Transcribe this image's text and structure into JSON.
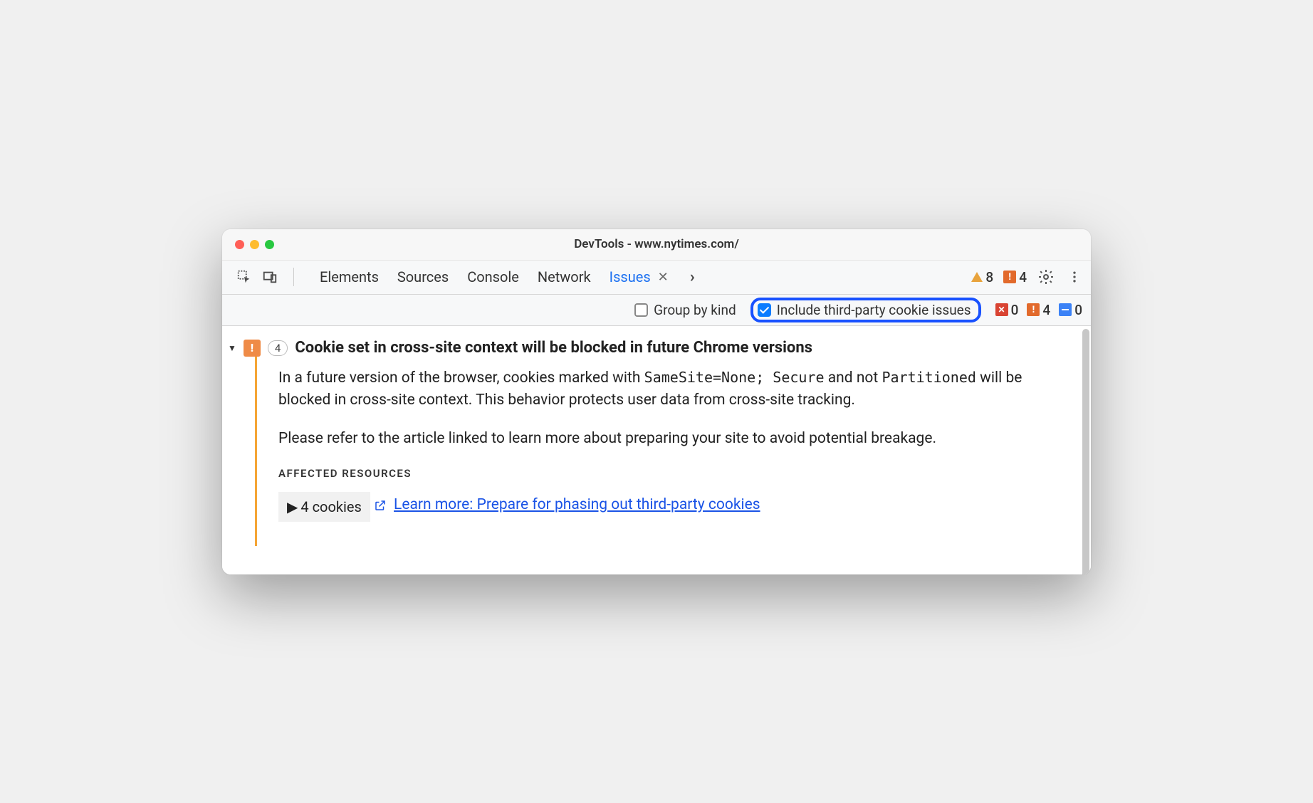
{
  "window_title": "DevTools - www.nytimes.com/",
  "tabs": {
    "elements": "Elements",
    "sources": "Sources",
    "console": "Console",
    "network": "Network",
    "issues": "Issues"
  },
  "toolbar_counts": {
    "warnings": "8",
    "breaking": "4"
  },
  "filter": {
    "group_by_kind_label": "Group by kind",
    "group_by_kind_checked": false,
    "third_party_label": "Include third-party cookie issues",
    "third_party_checked": true
  },
  "filter_counts": {
    "errors": "0",
    "warnings": "4",
    "info": "0"
  },
  "issue": {
    "count": "4",
    "title": "Cookie set in cross-site context will be blocked in future Chrome versions",
    "para1_pre": "In a future version of the browser, cookies marked with ",
    "code1": "SameSite=None; Secure",
    "para1_mid": " and not ",
    "code2": "Partitioned",
    "para1_post": " will be blocked in cross-site context. This behavior protects user data from cross-site tracking.",
    "para2": "Please refer to the article linked to learn more about preparing your site to avoid potential breakage.",
    "affected_label": "AFFECTED RESOURCES",
    "cookies_label": "4 cookies",
    "learn_more": "Learn more: Prepare for phasing out third-party cookies"
  }
}
